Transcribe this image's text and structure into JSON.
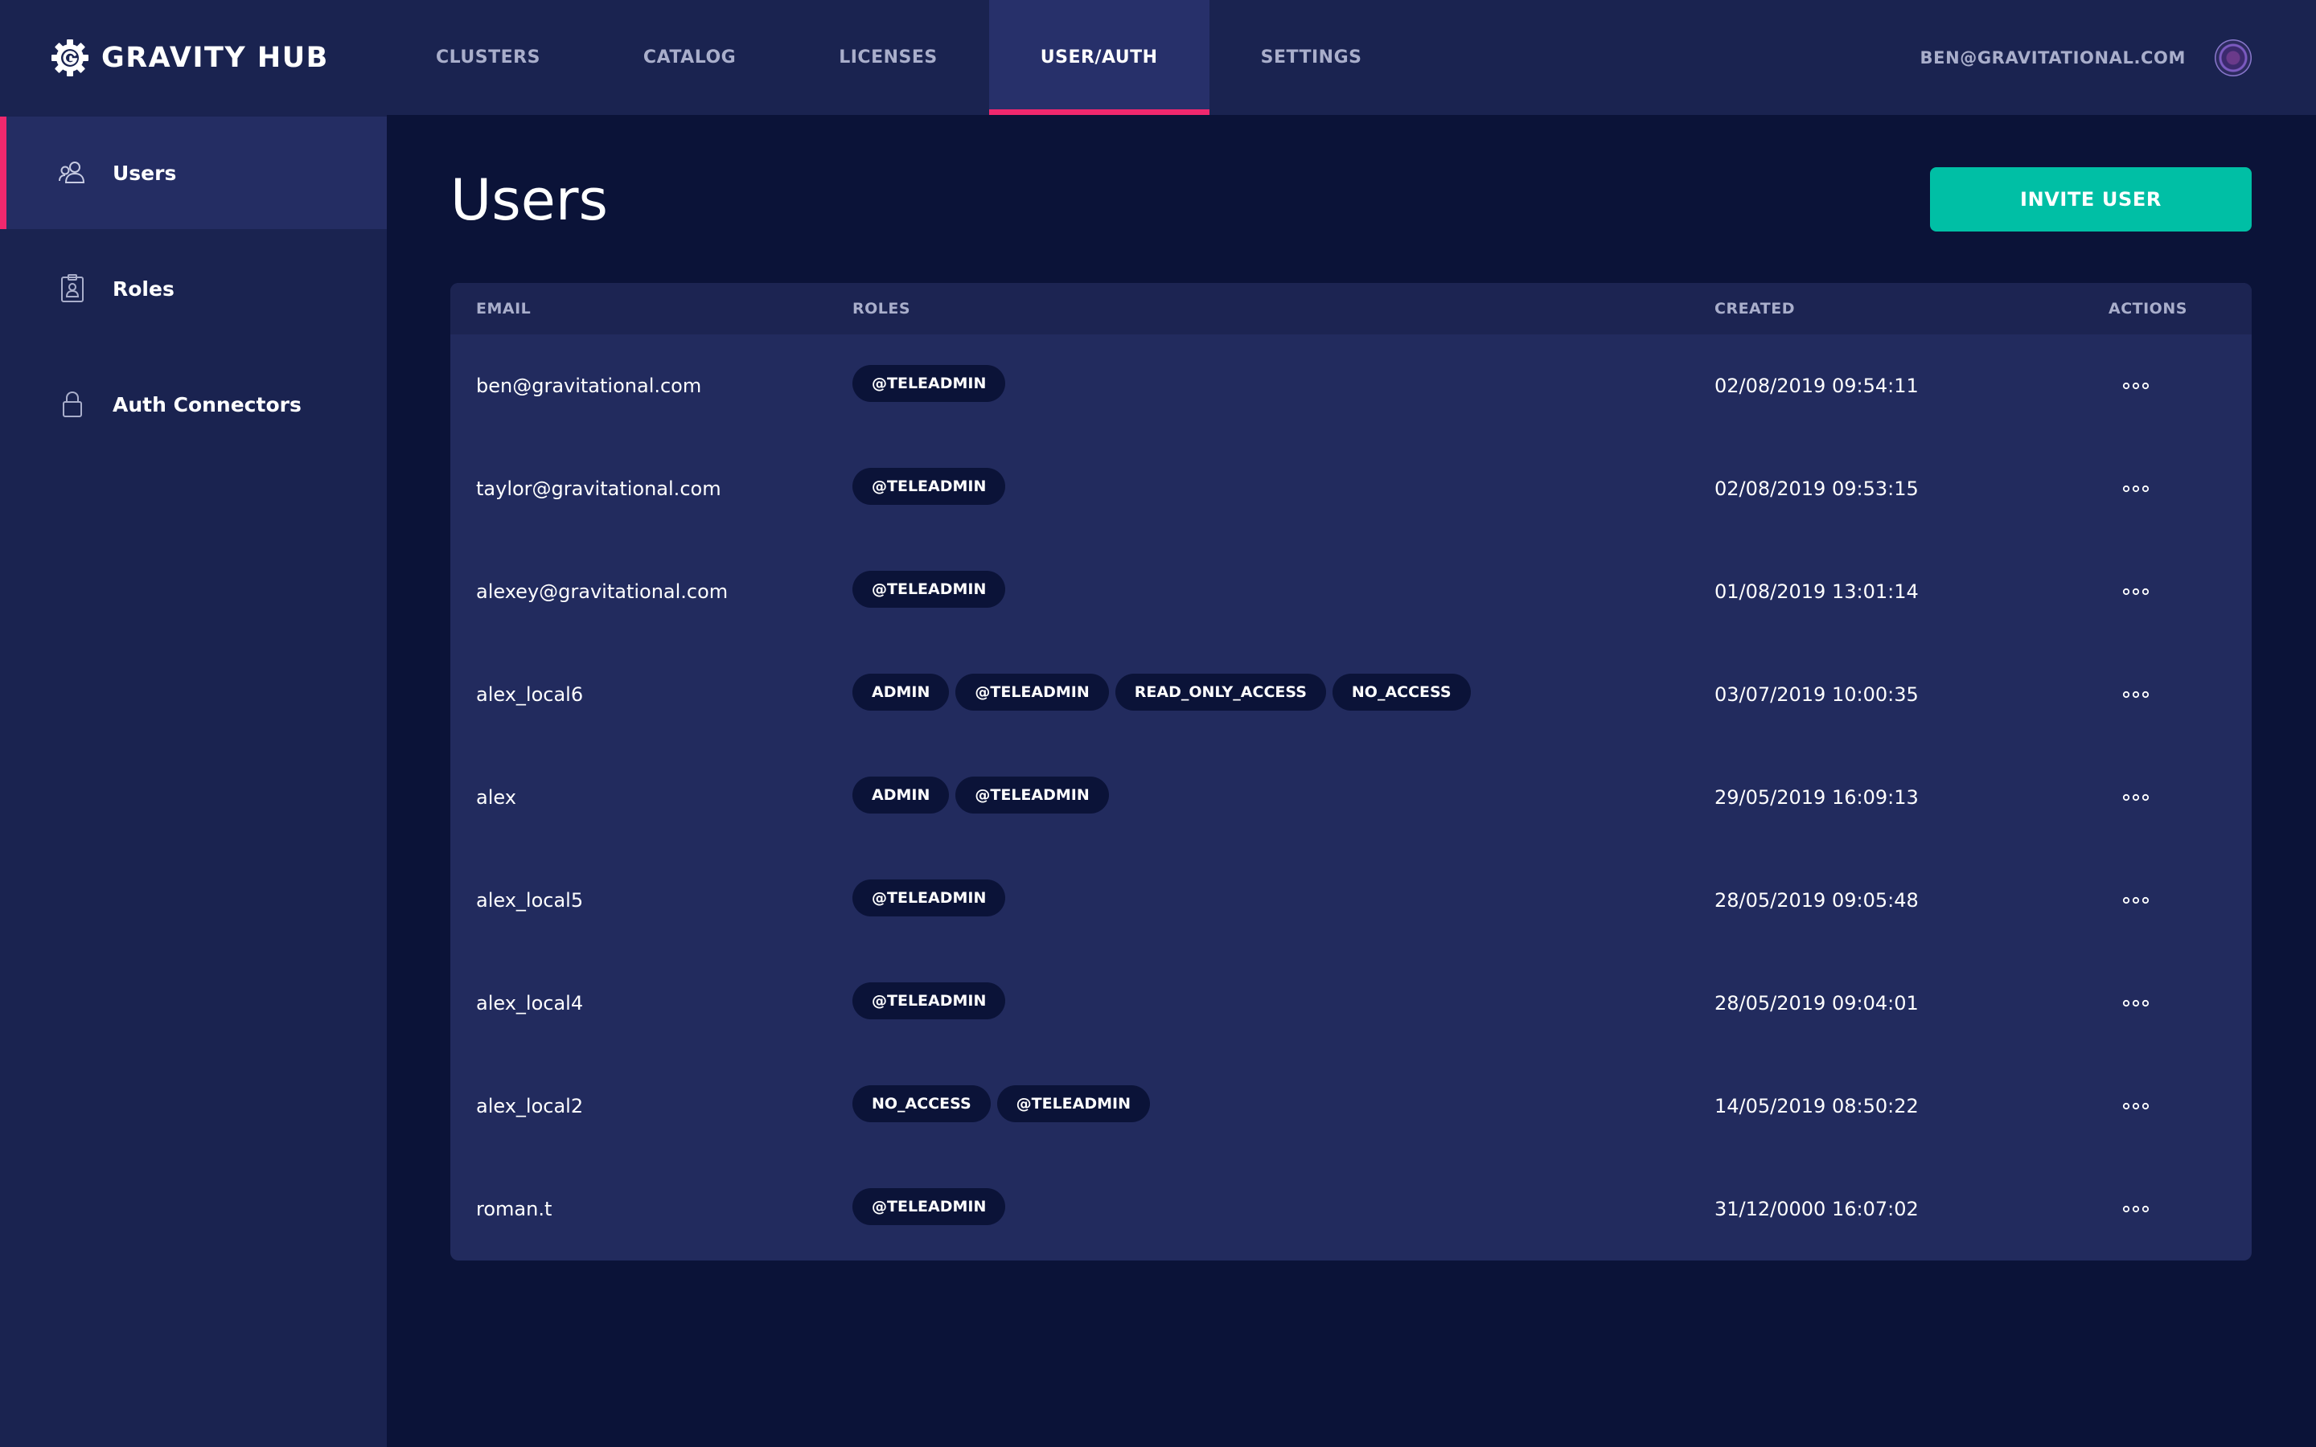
{
  "brand": {
    "name": "GRAVITY HUB"
  },
  "nav": [
    {
      "label": "CLUSTERS"
    },
    {
      "label": "CATALOG"
    },
    {
      "label": "LICENSES"
    },
    {
      "label": "USER/AUTH",
      "active": true
    },
    {
      "label": "SETTINGS"
    }
  ],
  "account": {
    "email": "BEN@GRAVITATIONAL.COM"
  },
  "sidebar": {
    "items": [
      {
        "label": "Users",
        "icon": "users-icon",
        "active": true
      },
      {
        "label": "Roles",
        "icon": "badge-icon"
      },
      {
        "label": "Auth Connectors",
        "icon": "lock-icon"
      }
    ]
  },
  "main": {
    "title": "Users",
    "invite_label": "INVITE USER"
  },
  "table": {
    "headers": {
      "email": "EMAIL",
      "roles": "ROLES",
      "created": "CREATED",
      "actions": "ACTIONS"
    },
    "rows": [
      {
        "email": "ben@gravitational.com",
        "roles": [
          "@TELEADMIN"
        ],
        "created": "02/08/2019 09:54:11"
      },
      {
        "email": "taylor@gravitational.com",
        "roles": [
          "@TELEADMIN"
        ],
        "created": "02/08/2019 09:53:15"
      },
      {
        "email": "alexey@gravitational.com",
        "roles": [
          "@TELEADMIN"
        ],
        "created": "01/08/2019 13:01:14"
      },
      {
        "email": "alex_local6",
        "roles": [
          "ADMIN",
          "@TELEADMIN",
          "READ_ONLY_ACCESS",
          "NO_ACCESS"
        ],
        "created": "03/07/2019 10:00:35"
      },
      {
        "email": "alex",
        "roles": [
          "ADMIN",
          "@TELEADMIN"
        ],
        "created": "29/05/2019 16:09:13"
      },
      {
        "email": "alex_local5",
        "roles": [
          "@TELEADMIN"
        ],
        "created": "28/05/2019 09:05:48"
      },
      {
        "email": "alex_local4",
        "roles": [
          "@TELEADMIN"
        ],
        "created": "28/05/2019 09:04:01"
      },
      {
        "email": "alex_local2",
        "roles": [
          "NO_ACCESS",
          "@TELEADMIN"
        ],
        "created": "14/05/2019 08:50:22"
      },
      {
        "email": "roman.t",
        "roles": [
          "@TELEADMIN"
        ],
        "created": "31/12/0000 16:07:02"
      }
    ]
  },
  "colors": {
    "accent": "#f0286e",
    "button": "#00bfa5",
    "background": "#0b1338",
    "panel": "#1a2350",
    "table": "#222b5e",
    "chip": "#0b1338"
  }
}
